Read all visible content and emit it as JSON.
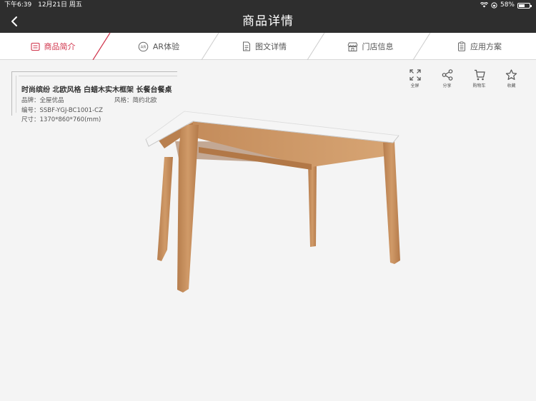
{
  "status": {
    "time": "下午6:39",
    "date": "12月21日 周五",
    "battery": "58%",
    "battery_level": 0.58
  },
  "nav": {
    "title": "商品详情",
    "back_icon": "chevron-left-icon"
  },
  "tabs": [
    {
      "label": "商品简介",
      "icon": "summary-icon",
      "active": true
    },
    {
      "label": "AR体验",
      "icon": "ar-icon",
      "active": false
    },
    {
      "label": "图文详情",
      "icon": "document-icon",
      "active": false
    },
    {
      "label": "门店信息",
      "icon": "store-icon",
      "active": false
    },
    {
      "label": "应用方案",
      "icon": "clipboard-icon",
      "active": false
    }
  ],
  "product": {
    "title": "时尚缤纷 北欧风格 白蜡木实木框架 长餐台餐桌",
    "brand_label": "品牌：",
    "brand": "全屋优品",
    "style_label": "风格：",
    "style": "简约北欧",
    "code_label": "编号：",
    "code": "SSBF-YGJ-BC1001-CZ",
    "size_label": "尺寸：",
    "size": "1370*860*760(mm)"
  },
  "actions": [
    {
      "label": "全屏",
      "icon": "fullscreen-icon"
    },
    {
      "label": "分享",
      "icon": "share-icon"
    },
    {
      "label": "购物车",
      "icon": "cart-icon"
    },
    {
      "label": "收藏",
      "icon": "star-icon"
    }
  ],
  "colors": {
    "bar": "#2e2e2e",
    "accent": "#d0334b",
    "wood": "#c18b5c",
    "tabletop": "#f2f2f2"
  }
}
